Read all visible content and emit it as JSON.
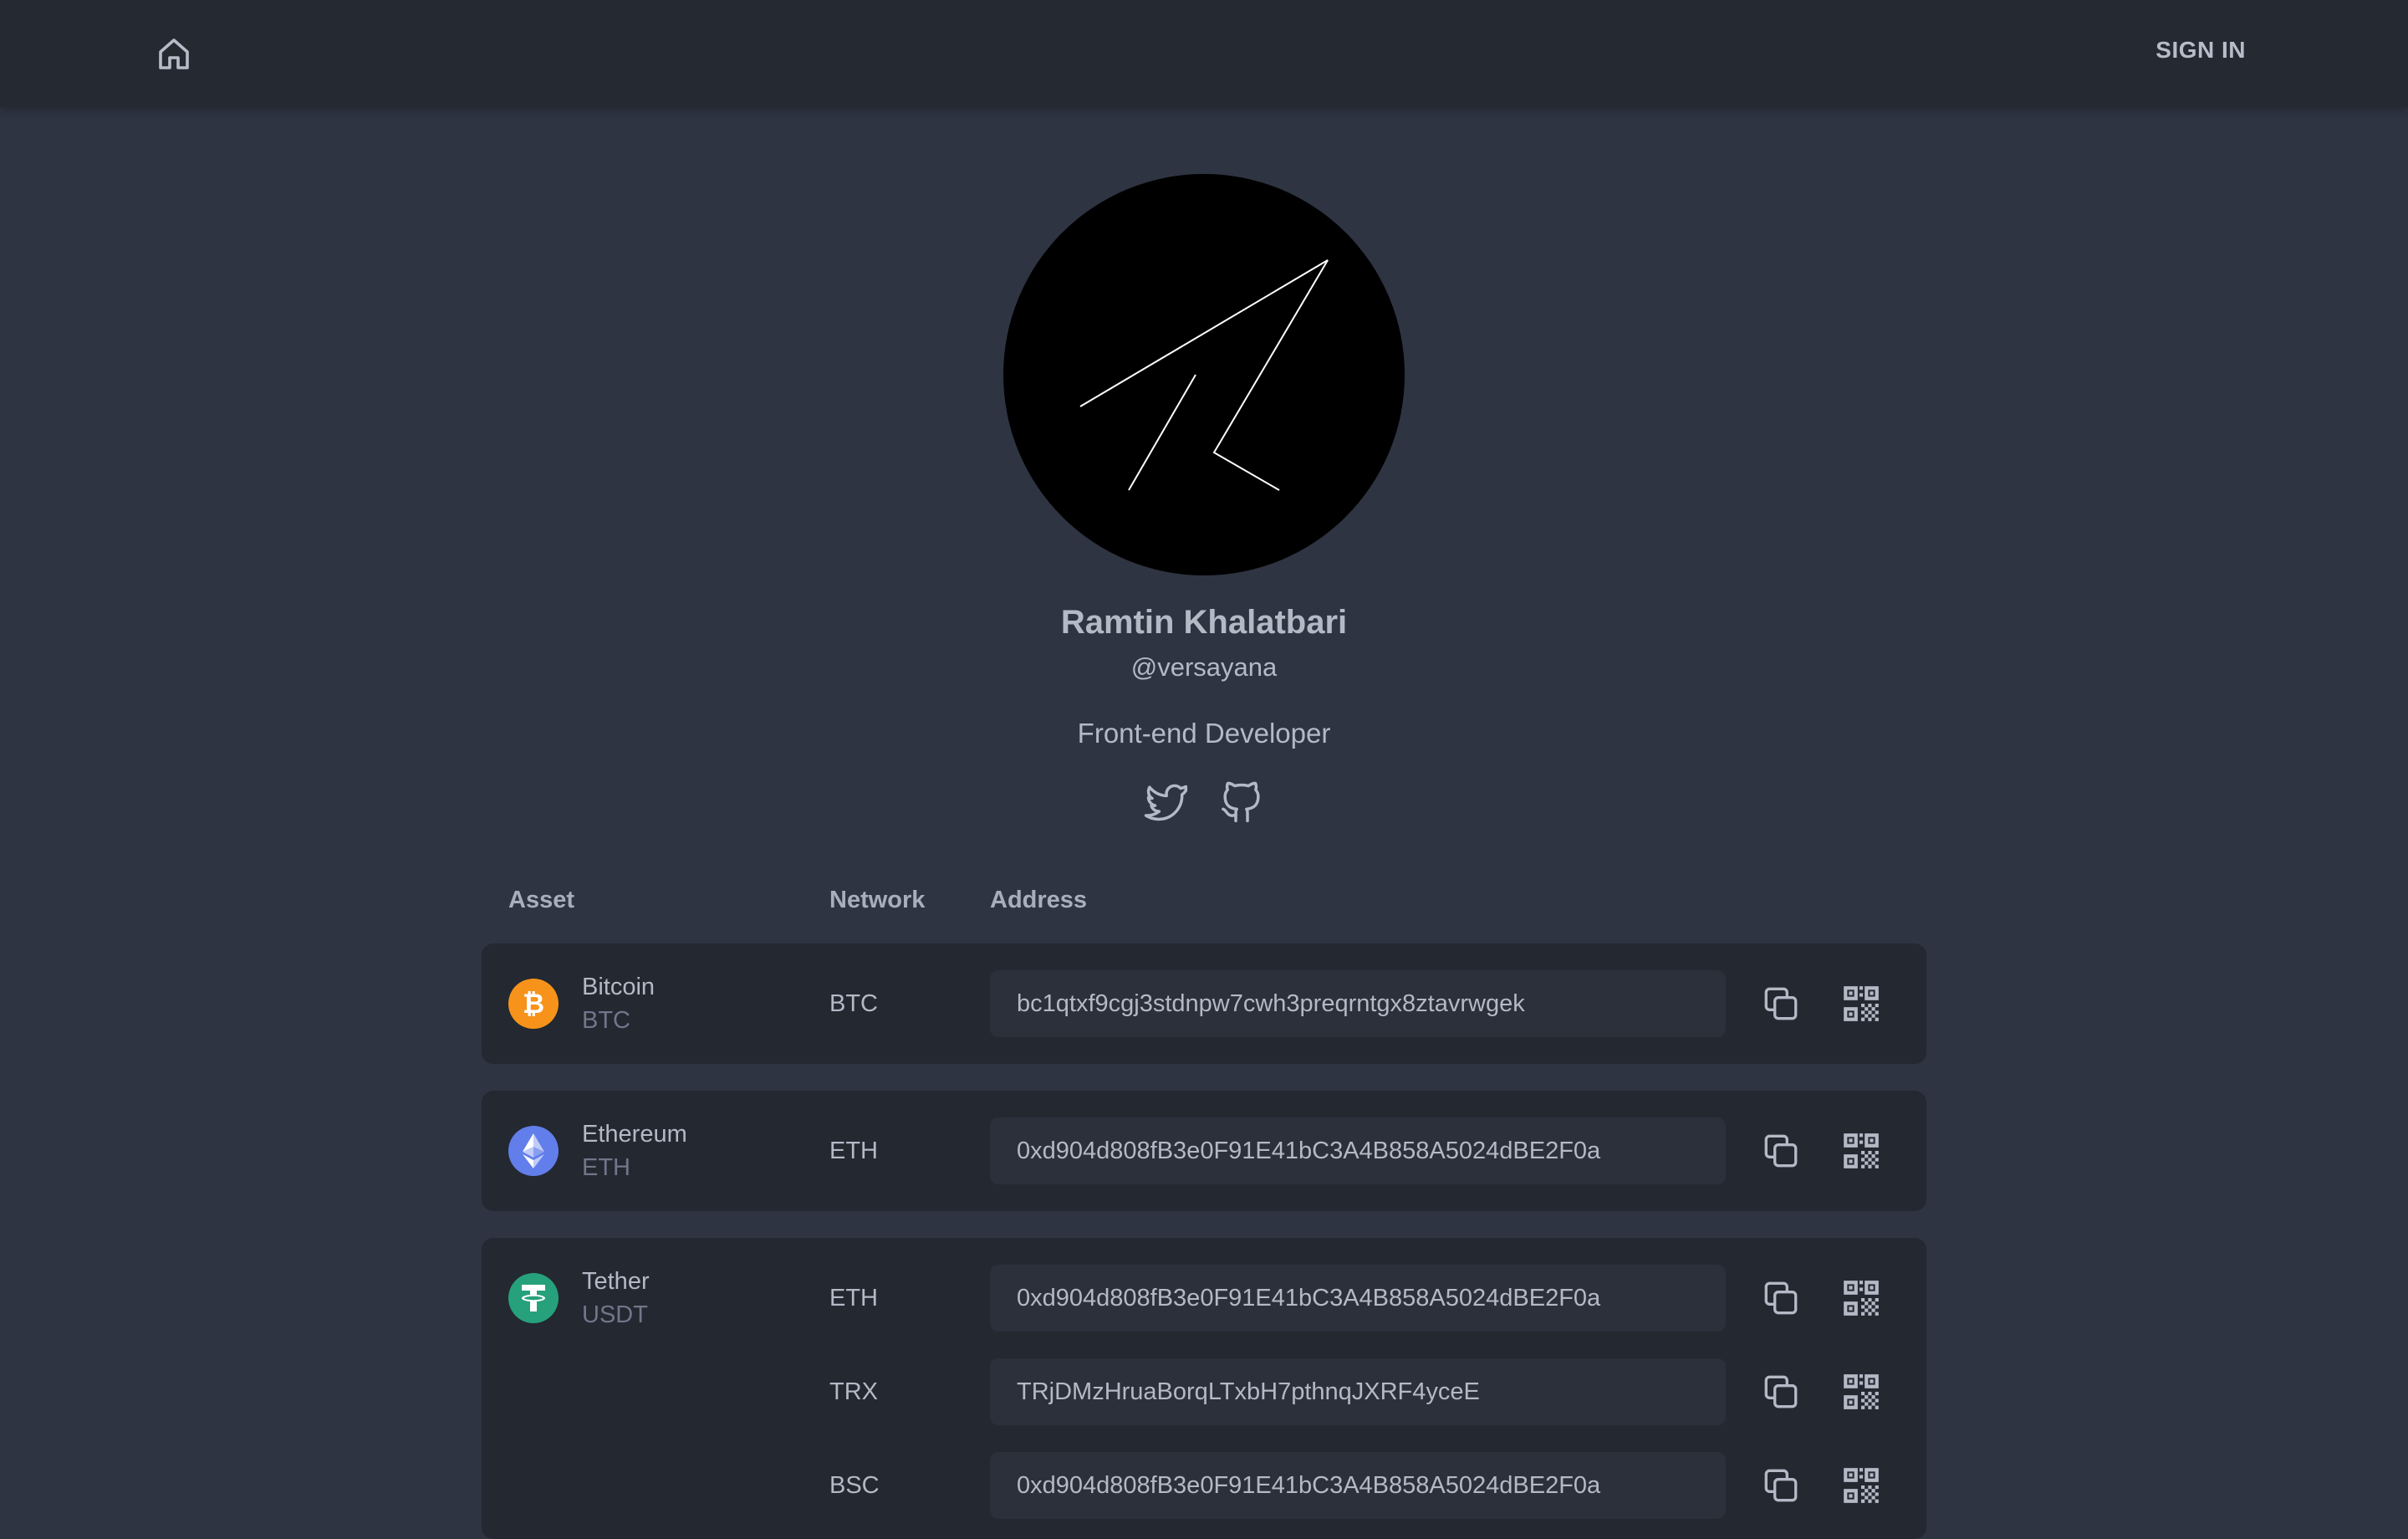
{
  "nav": {
    "home_icon": "home-icon",
    "sign_in_label": "SIGN IN"
  },
  "profile": {
    "name": "Ramtin Khalatbari",
    "handle": "@versayana",
    "bio": "Front-end Developer",
    "socials": [
      {
        "icon": "twitter-icon"
      },
      {
        "icon": "github-icon"
      }
    ]
  },
  "table": {
    "headers": {
      "asset": "Asset",
      "network": "Network",
      "address": "Address"
    },
    "rows": [
      {
        "asset_name": "Bitcoin",
        "asset_symbol": "BTC",
        "icon": "bitcoin-icon",
        "color": "#f7931a",
        "entries": [
          {
            "network": "BTC",
            "address": "bc1qtxf9cgj3stdnpw7cwh3preqrntgx8ztavrwgek"
          }
        ]
      },
      {
        "asset_name": "Ethereum",
        "asset_symbol": "ETH",
        "icon": "ethereum-icon",
        "color": "#627eea",
        "entries": [
          {
            "network": "ETH",
            "address": "0xd904d808fB3e0F91E41bC3A4B858A5024dBE2F0a"
          }
        ]
      },
      {
        "asset_name": "Tether",
        "asset_symbol": "USDT",
        "icon": "tether-icon",
        "color": "#26a17b",
        "entries": [
          {
            "network": "ETH",
            "address": "0xd904d808fB3e0F91E41bC3A4B858A5024dBE2F0a"
          },
          {
            "network": "TRX",
            "address": "TRjDMzHruaBorqLTxbH7pthnqJXRF4yceE"
          },
          {
            "network": "BSC",
            "address": "0xd904d808fB3e0F91E41bC3A4B858A5024dBE2F0a"
          }
        ]
      }
    ]
  },
  "actions": {
    "copy_icon": "copy-icon",
    "qr_icon": "qr-code-icon"
  },
  "colors": {
    "background": "#2e3441",
    "topbar": "#242932",
    "card": "#232831",
    "input": "#2b303b",
    "text": "#b3b9c5",
    "muted": "#70778a"
  }
}
